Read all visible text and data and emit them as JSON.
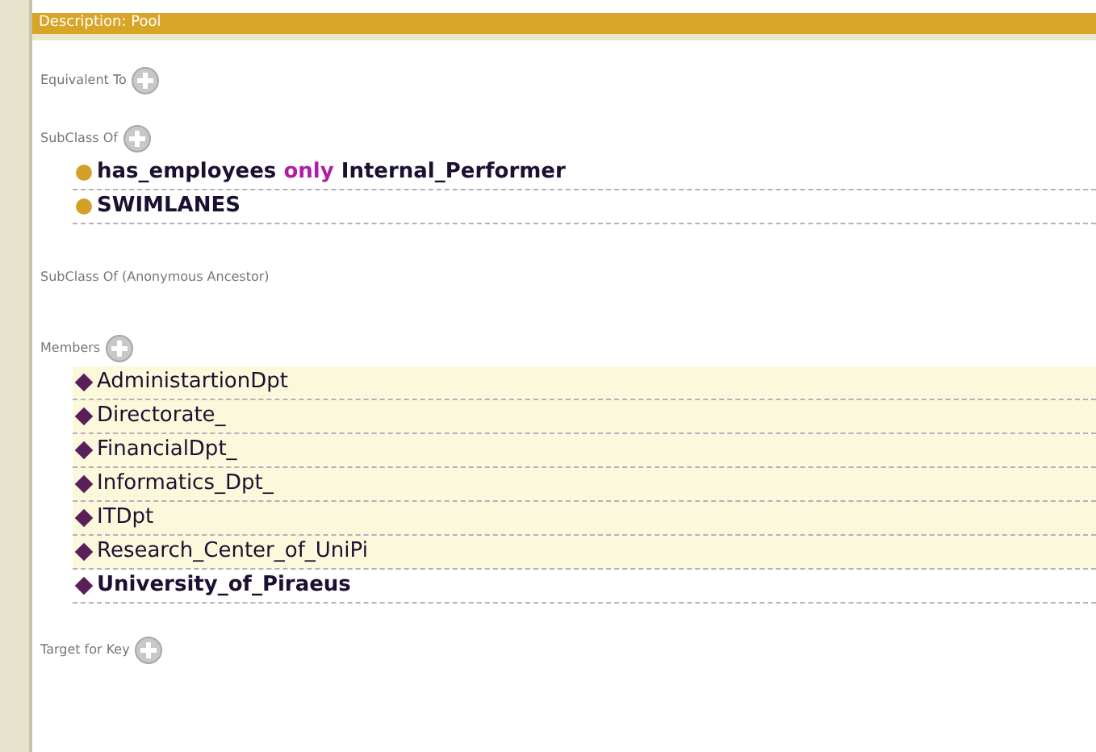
{
  "header": {
    "title": "Description: Pool"
  },
  "sections": [
    {
      "label": "Equivalent To",
      "addable": true
    },
    {
      "label": "SubClass Of",
      "addable": true,
      "items": [
        {
          "inferred": false,
          "parts": [
            {
              "kind": "name",
              "text": "has_employees"
            },
            {
              "kind": "keyword",
              "text": "only"
            },
            {
              "kind": "name",
              "text": "Internal_Performer"
            }
          ]
        },
        {
          "inferred": false,
          "parts": [
            {
              "kind": "name",
              "text": "SWIMLANES"
            }
          ]
        }
      ]
    },
    {
      "label": "SubClass Of (Anonymous Ancestor)",
      "addable": false
    },
    {
      "label": "Members",
      "addable": true,
      "items": [
        {
          "inferred": true,
          "parts": [
            {
              "kind": "individual",
              "text": "AdministartionDpt"
            }
          ]
        },
        {
          "inferred": true,
          "parts": [
            {
              "kind": "individual",
              "text": "Directorate_"
            }
          ]
        },
        {
          "inferred": true,
          "parts": [
            {
              "kind": "individual",
              "text": "FinancialDpt_"
            }
          ]
        },
        {
          "inferred": true,
          "parts": [
            {
              "kind": "individual",
              "text": "Informatics_Dpt_"
            }
          ]
        },
        {
          "inferred": true,
          "parts": [
            {
              "kind": "individual",
              "text": "ITDpt"
            }
          ]
        },
        {
          "inferred": true,
          "parts": [
            {
              "kind": "individual",
              "text": "Research_Center_of_UniPi"
            }
          ]
        },
        {
          "inferred": false,
          "parts": [
            {
              "kind": "individual",
              "text": "University_of_Piraeus"
            }
          ]
        }
      ]
    },
    {
      "label": "Target for Key",
      "addable": true
    }
  ]
}
